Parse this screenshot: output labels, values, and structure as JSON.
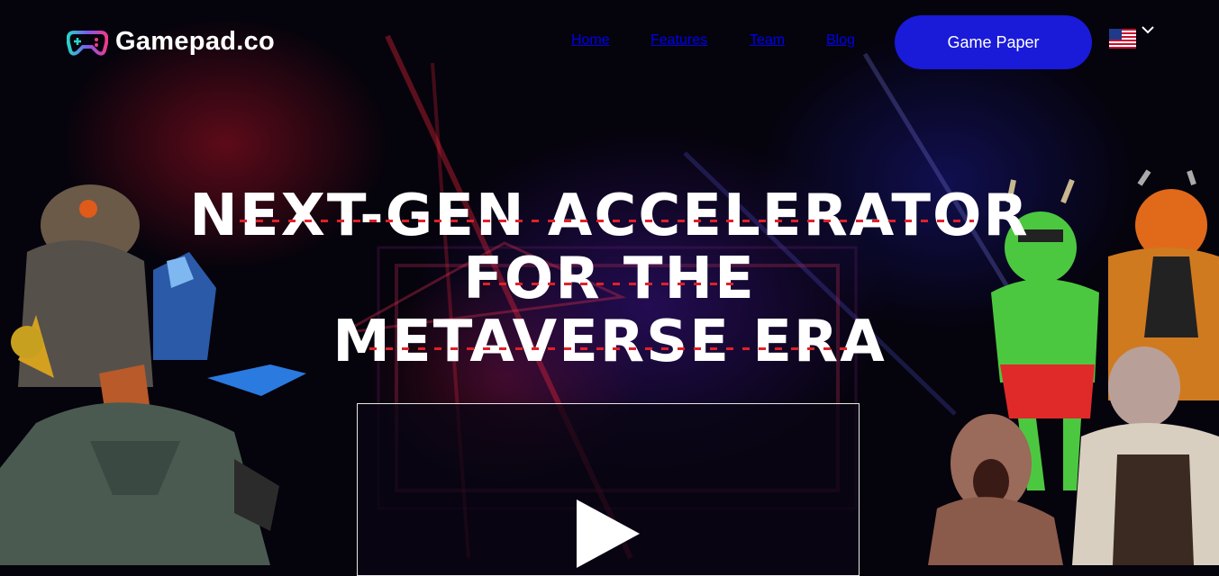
{
  "brand": {
    "name": "Gamepad.co",
    "logo_icon": "gamepad-icon"
  },
  "nav": {
    "items": [
      {
        "label": "Home"
      },
      {
        "label": "Features"
      },
      {
        "label": "Team"
      },
      {
        "label": "Blog"
      }
    ]
  },
  "cta": {
    "label": "Game Paper"
  },
  "language": {
    "flag": "us-flag-icon",
    "chevron": "chevron-down-icon"
  },
  "hero": {
    "headline_lines": [
      "NEXT-GEN ACCELERATOR",
      "FOR THE",
      "METAVERSE ERA"
    ],
    "video_control": "play-icon"
  },
  "colors": {
    "accent": "#1a1ad9",
    "background": "#05030c",
    "dash": "#e0202a"
  }
}
